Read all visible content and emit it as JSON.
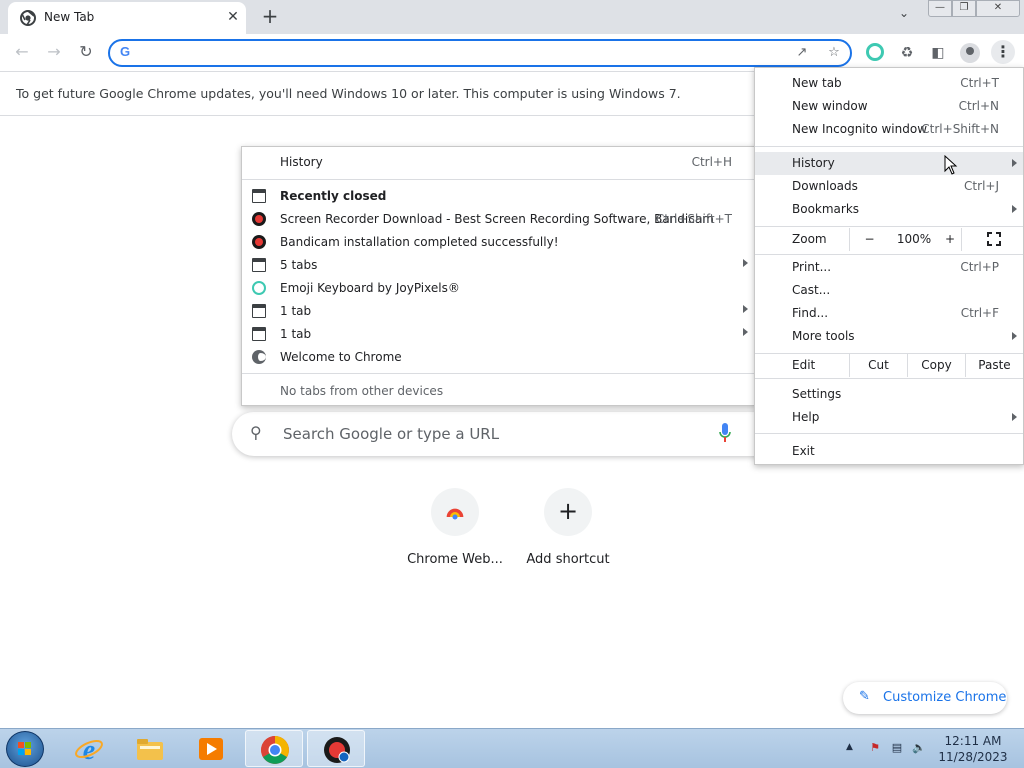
{
  "browser": {
    "tab": {
      "title": "New Tab"
    },
    "toolbar": {
      "omnibox_value": ""
    },
    "infobar": {
      "message": "To get future Google Chrome updates, you'll need Windows 10 or later. This computer is using Windows 7."
    }
  },
  "ntp": {
    "search_placeholder": "Search Google or type a URL",
    "shortcuts": [
      {
        "label": "Chrome Web...",
        "icon": "chrome-web-store-icon"
      },
      {
        "label": "Add shortcut",
        "icon": "plus-icon"
      }
    ],
    "customize_label": "Customize Chrome"
  },
  "history_menu": {
    "header": {
      "label": "History",
      "shortcut": "Ctrl+H"
    },
    "recently_closed_label": "Recently closed",
    "items": [
      {
        "label": "Screen Recorder Download - Best Screen Recording Software, Bandicam",
        "shortcut": "Ctrl+Shift+T",
        "icon": "bandicam-icon"
      },
      {
        "label": "Bandicam installation completed successfully!",
        "icon": "bandicam-icon"
      },
      {
        "label": "5 tabs",
        "icon": "tab-group-icon",
        "submenu": true
      },
      {
        "label": "Emoji Keyboard by JoyPixels®",
        "icon": "emoji-keyboard-icon"
      },
      {
        "label": "1 tab",
        "icon": "tab-group-icon",
        "submenu": true
      },
      {
        "label": "1 tab",
        "icon": "tab-group-icon",
        "submenu": true
      },
      {
        "label": "Welcome to Chrome",
        "icon": "globe-icon"
      }
    ],
    "footer": "No tabs from other devices"
  },
  "main_menu": {
    "new_tab": {
      "label": "New tab",
      "shortcut": "Ctrl+T"
    },
    "new_window": {
      "label": "New window",
      "shortcut": "Ctrl+N"
    },
    "new_incognito": {
      "label": "New Incognito window",
      "shortcut": "Ctrl+Shift+N"
    },
    "history": {
      "label": "History"
    },
    "downloads": {
      "label": "Downloads",
      "shortcut": "Ctrl+J"
    },
    "bookmarks": {
      "label": "Bookmarks"
    },
    "zoom": {
      "label": "Zoom",
      "minus": "−",
      "level": "100%",
      "plus": "+"
    },
    "print": {
      "label": "Print...",
      "shortcut": "Ctrl+P"
    },
    "cast": {
      "label": "Cast..."
    },
    "find": {
      "label": "Find...",
      "shortcut": "Ctrl+F"
    },
    "more_tools": {
      "label": "More tools"
    },
    "edit": {
      "label": "Edit",
      "cut": "Cut",
      "copy": "Copy",
      "paste": "Paste"
    },
    "settings": {
      "label": "Settings"
    },
    "help": {
      "label": "Help"
    },
    "exit": {
      "label": "Exit"
    }
  },
  "taskbar": {
    "clock_time": "12:11 AM",
    "clock_date": "11/28/2023"
  },
  "colors": {
    "accent": "#1a73e8",
    "taskbar": "#bcd3ea"
  }
}
